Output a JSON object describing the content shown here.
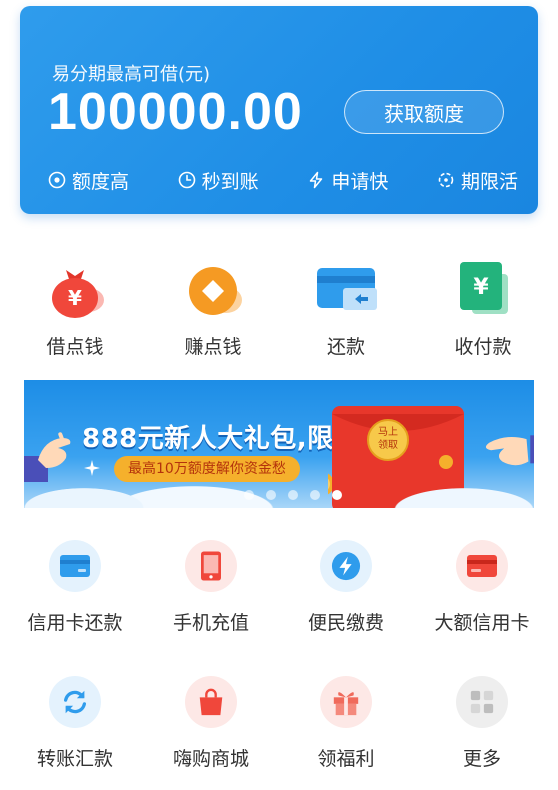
{
  "credit": {
    "label": "易分期最高可借(元)",
    "amount": "100000.00",
    "button": "获取额度",
    "features": [
      "额度高",
      "秒到账",
      "申请快",
      "期限活"
    ]
  },
  "top_actions": [
    {
      "label": "借点钱",
      "icon": "money-bag-icon",
      "color": "#f0473b"
    },
    {
      "label": "赚点钱",
      "icon": "coin-diamond-icon",
      "color": "#f59a23"
    },
    {
      "label": "还款",
      "icon": "card-return-icon",
      "color": "#2f9cec"
    },
    {
      "label": "收付款",
      "icon": "yuan-bill-icon",
      "color": "#23b37c"
    }
  ],
  "banner": {
    "headline": "888元新人大礼包,限时领",
    "subtitle": "最高10万额度解你资金愁",
    "envelope_text": "马上领取",
    "dots": 5,
    "active_dot": 4
  },
  "services": [
    {
      "label": "信用卡还款",
      "icon": "credit-card-icon",
      "color": "#2f9cec"
    },
    {
      "label": "手机充值",
      "icon": "mobile-phone-icon",
      "color": "#f0473b"
    },
    {
      "label": "便民缴费",
      "icon": "lightning-icon",
      "color": "#2f9cec"
    },
    {
      "label": "大额信用卡",
      "icon": "red-card-icon",
      "color": "#f0473b"
    },
    {
      "label": "转账汇款",
      "icon": "transfer-arrows-icon",
      "color": "#2f9cec"
    },
    {
      "label": "嗨购商城",
      "icon": "shopping-bag-icon",
      "color": "#f0473b"
    },
    {
      "label": "领福利",
      "icon": "gift-icon",
      "color": "#f06a5b"
    },
    {
      "label": "更多",
      "icon": "grid-more-icon",
      "color": "#bdbdbd"
    }
  ]
}
